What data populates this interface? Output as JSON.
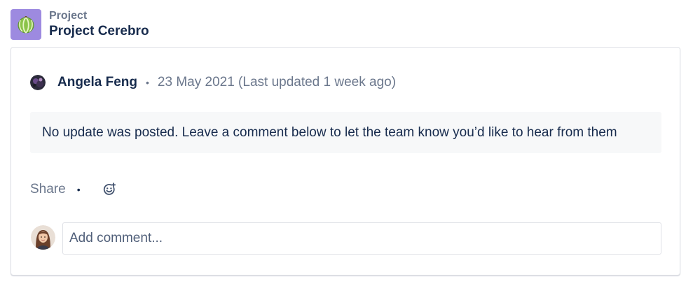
{
  "project": {
    "eyebrow": "Project",
    "name": "Project Cerebro",
    "icon": "melon-icon",
    "icon_bg": "#9d8ae0"
  },
  "update": {
    "author": "Angela Feng",
    "separator": "•",
    "date": "23 May 2021 (Last updated 1 week ago)",
    "notice": "No update was posted. Leave a comment below to let the team know you’d like to hear from them"
  },
  "actions": {
    "share_label": "Share",
    "separator": "•",
    "reaction_icon": "add-reaction-icon"
  },
  "comment": {
    "placeholder": "Add comment..."
  },
  "colors": {
    "text_primary": "#172b4d",
    "text_subtle": "#6b778c",
    "notice_bg": "#f7f8f9",
    "border": "#dfe1e6"
  }
}
